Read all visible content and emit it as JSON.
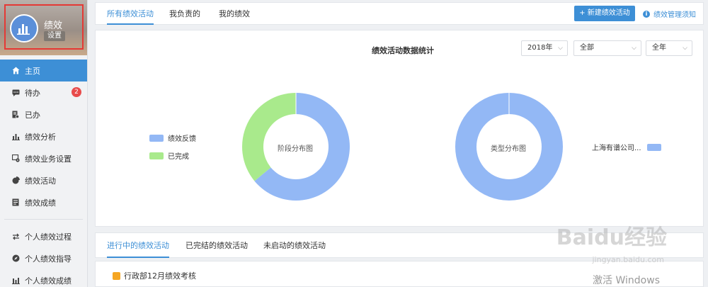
{
  "app": {
    "name": "绩效",
    "settings_label": "设置"
  },
  "sidebar": {
    "items": [
      {
        "label": "主页",
        "icon": "home-icon",
        "active": true
      },
      {
        "label": "待办",
        "icon": "chat-icon",
        "badge": "2"
      },
      {
        "label": "已办",
        "icon": "doc-check-icon"
      },
      {
        "label": "绩效分析",
        "icon": "bar-chart-icon"
      },
      {
        "label": "绩效业务设置",
        "icon": "settings-screen-icon"
      },
      {
        "label": "绩效活动",
        "icon": "pie-icon"
      },
      {
        "label": "绩效成绩",
        "icon": "document-icon"
      },
      {
        "label": "个人绩效过程",
        "icon": "exchange-icon"
      },
      {
        "label": "个人绩效指导",
        "icon": "compass-icon"
      },
      {
        "label": "个人绩效成绩",
        "icon": "bar-chart-icon"
      }
    ]
  },
  "topbar": {
    "tabs": [
      "所有绩效活动",
      "我负责的",
      "我的绩效"
    ],
    "new_button": "+ 新建绩效活动",
    "notice": "绩效管理须知"
  },
  "stats": {
    "title": "绩效活动数据统计",
    "filters": {
      "year": "2018年",
      "scope": "全部",
      "period": "全年"
    }
  },
  "chart_data": [
    {
      "type": "pie",
      "title": "阶段分布图",
      "categories": [
        "绩效反馈",
        "已完成"
      ],
      "values": [
        64,
        36
      ],
      "colors": [
        "#93b8f5",
        "#a9ea8c"
      ],
      "legend": "left"
    },
    {
      "type": "pie",
      "title": "类型分布图",
      "categories": [
        "上海有谱公司..."
      ],
      "values": [
        100
      ],
      "colors": [
        "#93b8f5"
      ],
      "legend": "right"
    }
  ],
  "bottom_tabs": [
    "进行中的绩效活动",
    "已完结的绩效活动",
    "未启动的绩效活动"
  ],
  "activities": [
    {
      "name": "行政部12月绩效考核"
    }
  ],
  "watermark": {
    "logo_text": "Baidu经验",
    "url": "jingyan.baidu.com"
  },
  "os_overlay": {
    "text": "激活 Windows"
  }
}
